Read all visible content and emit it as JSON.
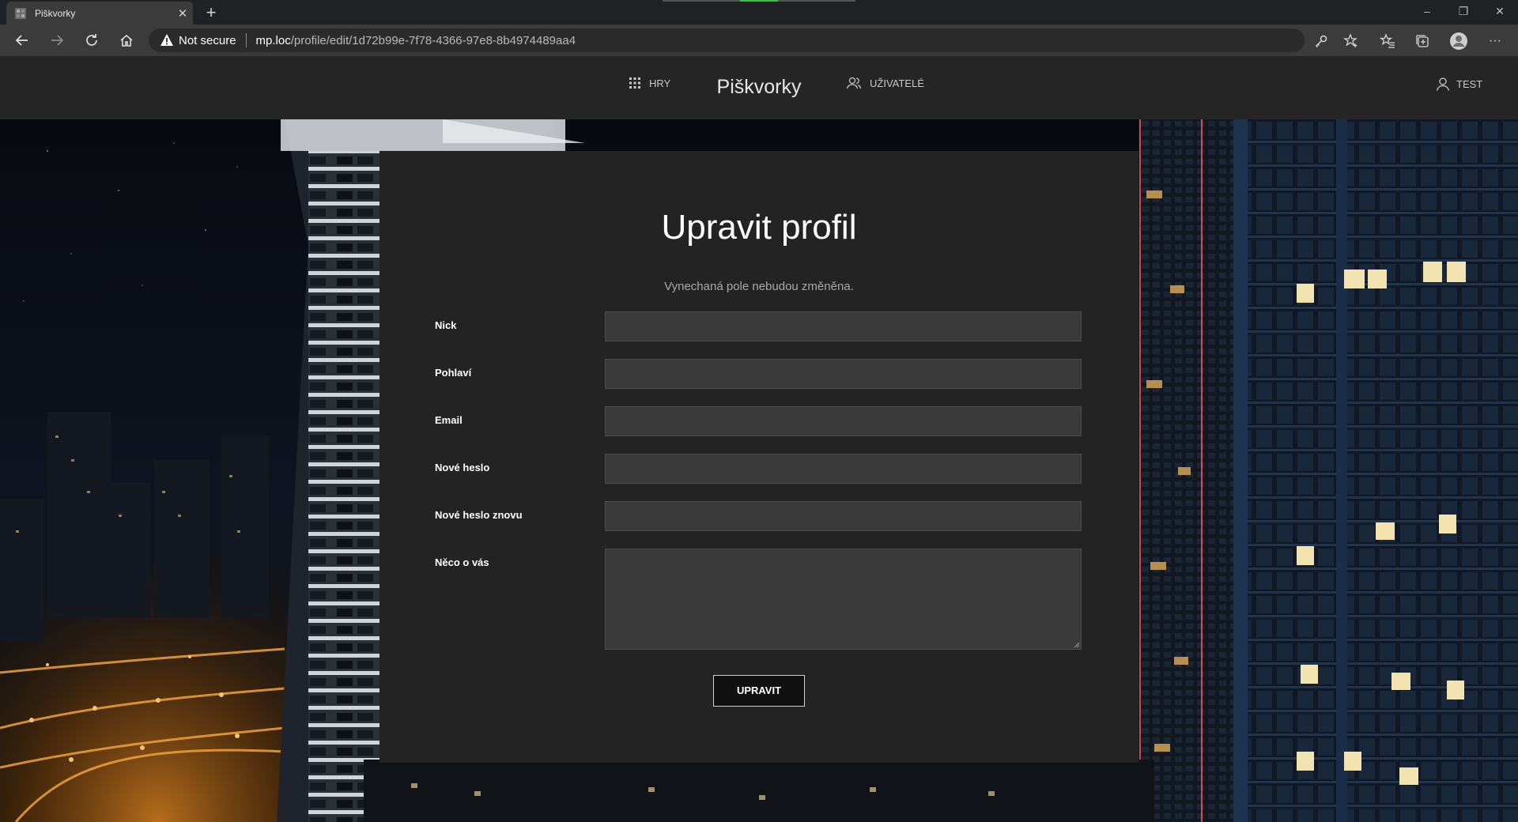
{
  "browser": {
    "tab_title": "Piškvorky",
    "new_tab": "+",
    "security_label": "Not secure",
    "url_host": "mp.loc",
    "url_path": "/profile/edit/1d72b99e-7f78-4366-97e8-8b4974489aa4",
    "window_minimize": "–",
    "window_restore": "❐",
    "window_close": "✕",
    "tab_close": "✕",
    "menu": "···"
  },
  "navbar": {
    "games_label": "HRY",
    "brand": "Piškvorky",
    "users_label": "UŽIVATELÉ",
    "user_label": "TEST"
  },
  "form": {
    "title": "Upravit profil",
    "subtitle": "Vynechaná pole nebudou změněna.",
    "fields": [
      {
        "label": "Nick",
        "value": ""
      },
      {
        "label": "Pohlaví",
        "value": ""
      },
      {
        "label": "Email",
        "value": ""
      },
      {
        "label": "Nové heslo",
        "value": ""
      },
      {
        "label": "Nové heslo znovu",
        "value": ""
      },
      {
        "label": "Něco o vás",
        "value": ""
      }
    ],
    "submit_label": "UPRAVIT"
  },
  "colors": {
    "chrome_bg": "#202124",
    "navbar_bg": "#252525",
    "panel_bg": "#232323",
    "field_bg": "#3a3a3a"
  }
}
